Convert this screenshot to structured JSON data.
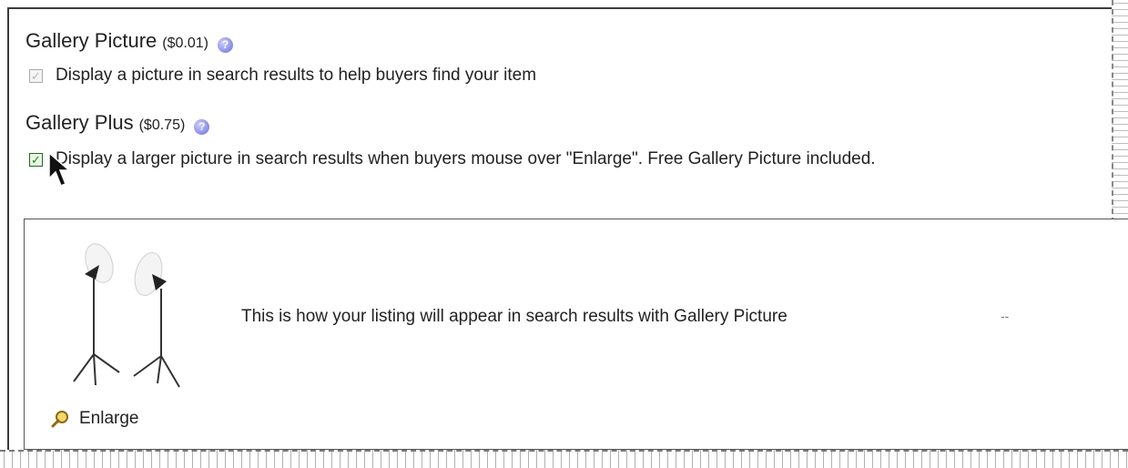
{
  "gallery_picture": {
    "title": "Gallery Picture",
    "price": "($0.01)",
    "help_icon": "help-icon",
    "option_label": "Display a picture in search results to help buyers find your item",
    "checked": true,
    "disabled": true
  },
  "gallery_plus": {
    "title": "Gallery Plus",
    "price": "($0.75)",
    "help_icon": "help-icon",
    "option_label": "Display a larger picture in search results when buyers mouse over \"Enlarge\". Free Gallery Picture included.",
    "checked": true
  },
  "preview": {
    "description": "This is how your listing will appear in search results with Gallery Picture",
    "placeholder": "--",
    "enlarge_label": "Enlarge",
    "enlarge_icon": "magnifier-icon"
  },
  "colors": {
    "help_icon": "#6a6fd8",
    "checkbox_green": "#1b8a1b",
    "frame": "#3b3b3b"
  }
}
